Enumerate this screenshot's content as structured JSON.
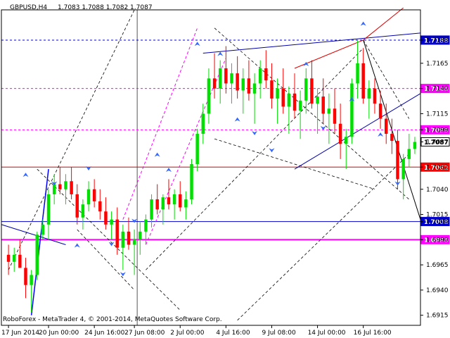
{
  "header": {
    "symbol": "GBPUSD,H4",
    "ohlc": "1.7083 1.7088 1.7082 1.7087"
  },
  "footer": {
    "copyright": "RoboForex - MetaTrader 4, © 2001-2014, MetaQuotes Software Corp."
  },
  "colors": {
    "bull": "#00e000",
    "bear": "#ff0000",
    "blue_level": "#0000cc",
    "magenta_level": "#ff00ff",
    "red_level": "#e00000",
    "trend_line": "#0000aa",
    "marker": "#3366ff"
  },
  "chart_data": {
    "type": "candlestick",
    "ylim": [
      1.6905,
      1.7218
    ],
    "y_ticks": [
      "1.7188",
      "1.7165",
      "1.7140",
      "1.7115",
      "1.7099",
      "1.7087",
      "1.7062",
      "1.7040",
      "1.7015",
      "1.7008",
      "1.6990",
      "1.6965",
      "1.6940",
      "1.6915"
    ],
    "x_ticks": [
      "17 Jun 2014",
      "20 Jun 00:00",
      "24 Jun 16:00",
      "27 Jun 08:00",
      "2 Jul 00:00",
      "4 Jul 16:00",
      "9 Jul 08:00",
      "14 Jul 00:00",
      "16 Jul 16:00"
    ],
    "levels": [
      {
        "value": 1.7188,
        "label": "1.7188",
        "color": "blue",
        "style": "dashed"
      },
      {
        "value": 1.714,
        "label": "1.7140",
        "color": "magenta",
        "style": "dashed"
      },
      {
        "value": 1.7099,
        "label": "1.7099",
        "color": "magenta",
        "style": "dashed"
      },
      {
        "value": 1.7087,
        "label": "1.7087",
        "color": "current",
        "style": "none"
      },
      {
        "value": 1.7062,
        "label": "1.7062",
        "color": "red",
        "style": "solid"
      },
      {
        "value": 1.7008,
        "label": "1.7008",
        "color": "blue",
        "style": "solid"
      },
      {
        "value": 1.699,
        "label": "1.6990",
        "color": "magenta",
        "style": "solid"
      }
    ],
    "candles": [
      [
        1.6975,
        1.6985,
        1.6955,
        1.6968
      ],
      [
        1.6968,
        1.6982,
        1.6958,
        1.6975
      ],
      [
        1.6975,
        1.699,
        1.6965,
        1.6962
      ],
      [
        1.6962,
        1.6972,
        1.6932,
        1.6945
      ],
      [
        1.6945,
        1.696,
        1.6918,
        1.6955
      ],
      [
        1.6955,
        1.6998,
        1.695,
        1.6995
      ],
      [
        1.6995,
        1.701,
        1.699,
        1.7005
      ],
      [
        1.7005,
        1.704,
        1.699,
        1.7035
      ],
      [
        1.7035,
        1.7055,
        1.7025,
        1.7045
      ],
      [
        1.7045,
        1.7062,
        1.7035,
        1.704
      ],
      [
        1.704,
        1.7055,
        1.7025,
        1.7048
      ],
      [
        1.7048,
        1.7062,
        1.703,
        1.7035
      ],
      [
        1.7035,
        1.7045,
        1.7005,
        1.7012
      ],
      [
        1.7012,
        1.703,
        1.7,
        1.7025
      ],
      [
        1.7025,
        1.7048,
        1.7018,
        1.704
      ],
      [
        1.704,
        1.705,
        1.7022,
        1.7028
      ],
      [
        1.7028,
        1.704,
        1.701,
        1.7018
      ],
      [
        1.7018,
        1.7032,
        1.7,
        1.7005
      ],
      [
        1.7005,
        1.7018,
        1.699,
        1.701
      ],
      [
        1.701,
        1.7022,
        1.6975,
        1.6982
      ],
      [
        1.6982,
        1.7005,
        1.696,
        1.6998
      ],
      [
        1.6998,
        1.7012,
        1.698,
        1.6985
      ],
      [
        1.6985,
        1.7,
        1.6955,
        1.699
      ],
      [
        1.699,
        1.7008,
        1.6975,
        1.6998
      ],
      [
        1.6998,
        1.7015,
        1.6985,
        1.701
      ],
      [
        1.701,
        1.7035,
        1.7002,
        1.703
      ],
      [
        1.703,
        1.7045,
        1.7015,
        1.702
      ],
      [
        1.702,
        1.7035,
        1.7005,
        1.7032
      ],
      [
        1.7032,
        1.705,
        1.702,
        1.7025
      ],
      [
        1.7025,
        1.704,
        1.701,
        1.7035
      ],
      [
        1.7035,
        1.7048,
        1.7018,
        1.7022
      ],
      [
        1.7022,
        1.7038,
        1.701,
        1.703
      ],
      [
        1.703,
        1.707,
        1.7025,
        1.7065
      ],
      [
        1.7065,
        1.71,
        1.7058,
        1.7095
      ],
      [
        1.7095,
        1.7125,
        1.7085,
        1.7115
      ],
      [
        1.7115,
        1.716,
        1.7105,
        1.715
      ],
      [
        1.715,
        1.7175,
        1.713,
        1.714
      ],
      [
        1.714,
        1.7168,
        1.7125,
        1.716
      ],
      [
        1.716,
        1.7182,
        1.7135,
        1.7145
      ],
      [
        1.7145,
        1.7165,
        1.7125,
        1.7155
      ],
      [
        1.7155,
        1.7172,
        1.713,
        1.7138
      ],
      [
        1.7138,
        1.716,
        1.7115,
        1.715
      ],
      [
        1.715,
        1.7168,
        1.7128,
        1.7135
      ],
      [
        1.7135,
        1.7155,
        1.7105,
        1.7145
      ],
      [
        1.7145,
        1.7168,
        1.713,
        1.716
      ],
      [
        1.716,
        1.7178,
        1.714,
        1.7148
      ],
      [
        1.7148,
        1.7165,
        1.712,
        1.713
      ],
      [
        1.713,
        1.715,
        1.7105,
        1.714
      ],
      [
        1.714,
        1.716,
        1.7115,
        1.7122
      ],
      [
        1.7122,
        1.7142,
        1.7095,
        1.7135
      ],
      [
        1.7135,
        1.7155,
        1.711,
        1.7118
      ],
      [
        1.7118,
        1.7138,
        1.709,
        1.7128
      ],
      [
        1.7128,
        1.716,
        1.7115,
        1.715
      ],
      [
        1.715,
        1.7168,
        1.712,
        1.7125
      ],
      [
        1.7125,
        1.714,
        1.7095,
        1.7132
      ],
      [
        1.7132,
        1.715,
        1.7105,
        1.7115
      ],
      [
        1.7115,
        1.7135,
        1.7085,
        1.712
      ],
      [
        1.712,
        1.714,
        1.7095,
        1.7105
      ],
      [
        1.7105,
        1.7125,
        1.707,
        1.7085
      ],
      [
        1.7085,
        1.71,
        1.706,
        1.7092
      ],
      [
        1.7092,
        1.715,
        1.7085,
        1.7145
      ],
      [
        1.7145,
        1.7188,
        1.713,
        1.7165
      ],
      [
        1.7165,
        1.718,
        1.7125,
        1.713
      ],
      [
        1.713,
        1.7148,
        1.711,
        1.714
      ],
      [
        1.714,
        1.715,
        1.7115,
        1.7125
      ],
      [
        1.7125,
        1.7138,
        1.71,
        1.711
      ],
      [
        1.711,
        1.7125,
        1.7085,
        1.7095
      ],
      [
        1.7095,
        1.711,
        1.7075,
        1.7088
      ],
      [
        1.7088,
        1.7099,
        1.704,
        1.705
      ],
      [
        1.705,
        1.7075,
        1.703,
        1.707
      ],
      [
        1.707,
        1.7095,
        1.7062,
        1.708
      ],
      [
        1.708,
        1.7092,
        1.7075,
        1.7087
      ]
    ]
  }
}
